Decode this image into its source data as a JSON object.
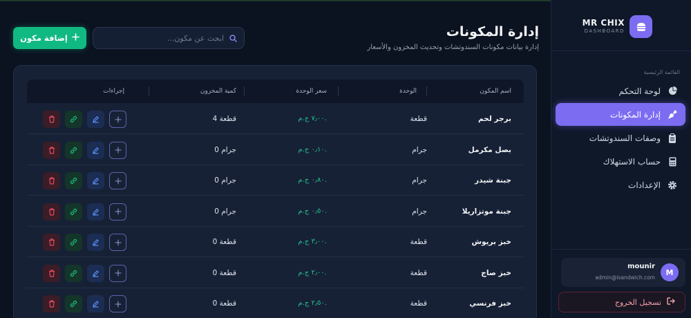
{
  "brand": {
    "name": "MR CHIX",
    "sub": "DASHBOARD"
  },
  "nav": {
    "caption": "القائمة الرئيسية",
    "items": [
      {
        "label": "لوحة التحكم",
        "icon": "pie-chart-icon",
        "active": false
      },
      {
        "label": "إدارة المكونات",
        "icon": "carrot-icon",
        "active": true
      },
      {
        "label": "وصفات السندوتشات",
        "icon": "clipboard-icon",
        "active": false
      },
      {
        "label": "حساب الاستهلاك",
        "icon": "calculator-icon",
        "active": false
      },
      {
        "label": "الإعدادات",
        "icon": "gear-icon",
        "active": false
      }
    ]
  },
  "user": {
    "initial": "M",
    "name": "mounir",
    "email": "admin@isandwich.com"
  },
  "logout_label": "تسجيل الخروج",
  "header": {
    "title": "إدارة المكونات",
    "subtitle": "إدارة بيانات مكونات السندوتشات وتحديث المخزون والأسعار",
    "search_placeholder": "ابحث عن مكون...",
    "add_label": "إضافة مكون"
  },
  "table": {
    "columns": [
      "اسم المكون",
      "الوحدة",
      "سعر الوحدة",
      "كمية المخزون",
      "إجراءات"
    ],
    "rows": [
      {
        "name": "برجر لحم",
        "unit": "قطعة",
        "price": "٧٫٠٠ ج.م.",
        "stock": "4 قطعة"
      },
      {
        "name": "بصل مكرمل",
        "unit": "جرام",
        "price": "٠٫١٠ ج.م.",
        "stock": "0 جرام"
      },
      {
        "name": "جبنة شيدر",
        "unit": "جرام",
        "price": "٠٫٨٠ ج.م.",
        "stock": "0 جرام"
      },
      {
        "name": "جبنة موتزاريلا",
        "unit": "جرام",
        "price": "٠٫٥٠ ج.م.",
        "stock": "0 جرام"
      },
      {
        "name": "خبز بريوش",
        "unit": "قطعة",
        "price": "٣٫٠٠ ج.م.",
        "stock": "0 قطعة"
      },
      {
        "name": "خبز صاج",
        "unit": "قطعة",
        "price": "٢٫٠٠ ج.م.",
        "stock": "0 قطعة"
      },
      {
        "name": "خبز فرنسي",
        "unit": "قطعة",
        "price": "٢٫٥٠ ج.م.",
        "stock": "0 قطعة"
      }
    ]
  },
  "colors": {
    "accent": "#7c6cf2",
    "success": "#10b981",
    "danger": "#f4a0aa",
    "background": "#0b1220"
  }
}
